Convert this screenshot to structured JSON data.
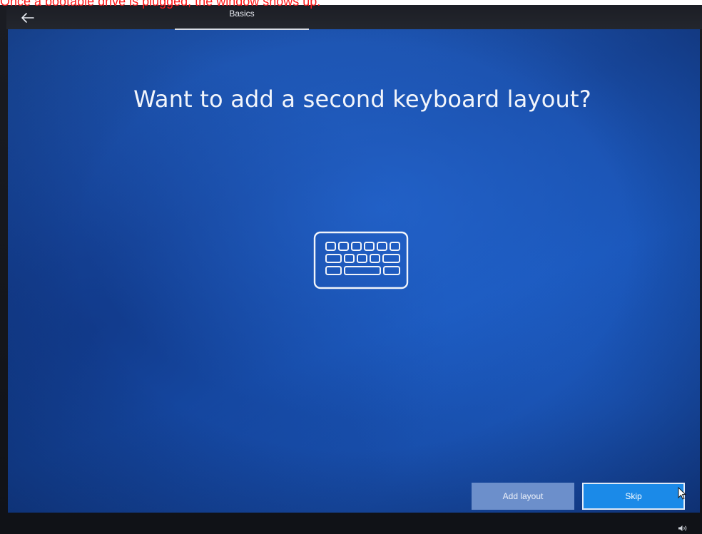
{
  "caption": {
    "text": "Once a bootable drive is plugged, the window shows up:"
  },
  "topbar": {
    "step_label": "Basics"
  },
  "main": {
    "title": "Want to add a second keyboard layout?"
  },
  "buttons": {
    "add_layout": "Add layout",
    "skip": "Skip"
  },
  "icons": {
    "back": "back-arrow-icon",
    "keyboard": "keyboard-icon",
    "cursor": "mouse-cursor-icon",
    "volume": "volume-icon"
  },
  "colors": {
    "screen_blue": "#1a4ea9",
    "skip_button": "#1b8ae8",
    "add_layout_button": "#6c8fcb",
    "caption_red": "#ff1a1a"
  }
}
